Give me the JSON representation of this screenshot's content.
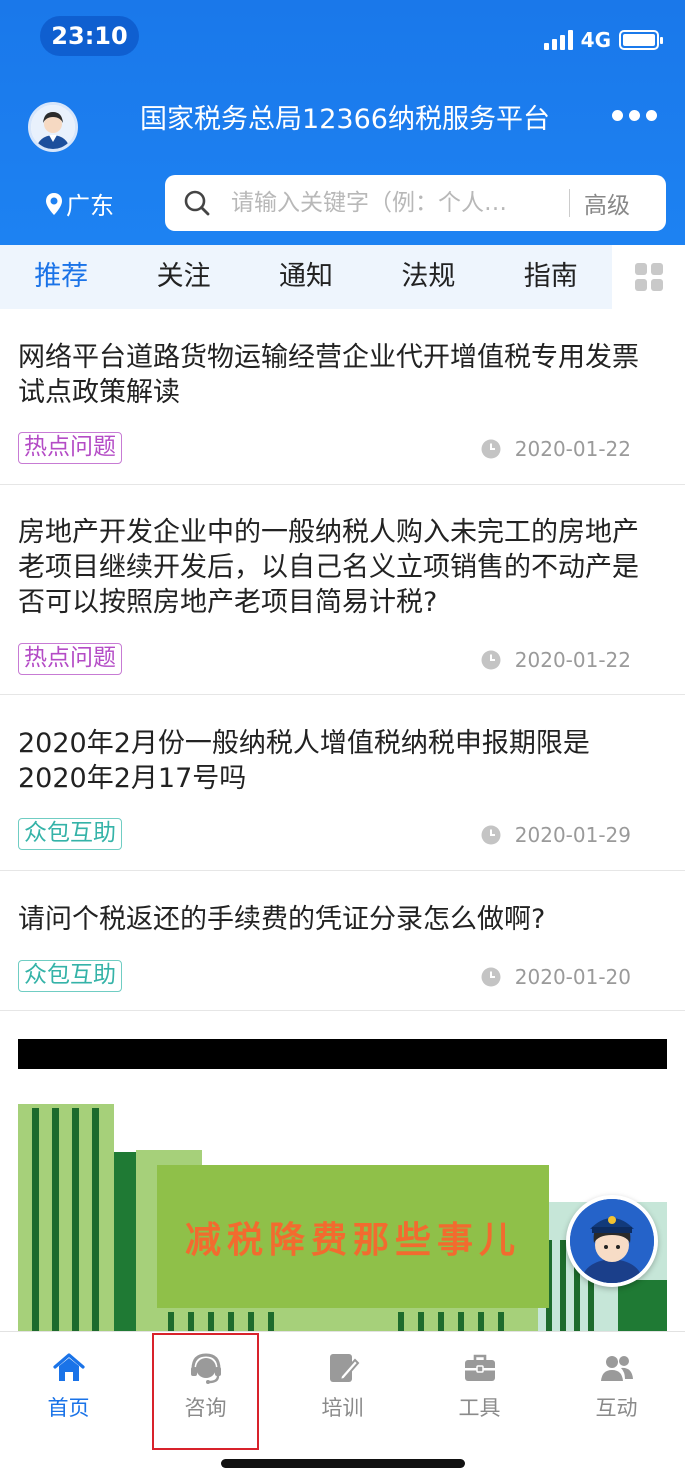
{
  "status_bar": {
    "time": "23:10",
    "network": "4G"
  },
  "header": {
    "title": "国家税务总局12366纳税服务平台",
    "location": "广东",
    "search": {
      "placeholder": "请输入关键字（例：个人…",
      "advanced_label": "高级"
    }
  },
  "tabs": [
    {
      "label": "推荐",
      "active": true
    },
    {
      "label": "关注",
      "active": false
    },
    {
      "label": "通知",
      "active": false
    },
    {
      "label": "法规",
      "active": false
    },
    {
      "label": "指南",
      "active": false
    }
  ],
  "articles": [
    {
      "title": "网络平台道路货物运输经营企业代开增值税专用发票试点政策解读",
      "tag": "热点问题",
      "date": "2020-01-22"
    },
    {
      "title": "房地产开发企业中的一般纳税人购入未完工的房地产老项目继续开发后，以自己名义立项销售的不动产是否可以按照房地产老项目简易计税?",
      "tag": "热点问题",
      "date": "2020-01-22"
    },
    {
      "title": "2020年2月份一般纳税人增值税纳税申报期限是2020年2月17号吗",
      "tag": "众包互助",
      "date": "2020-01-29"
    },
    {
      "title": "请问个税返还的手续费的凭证分录怎么做啊?",
      "tag": "众包互助",
      "date": "2020-01-20"
    }
  ],
  "banner": {
    "text": "减税降费那些事儿"
  },
  "bottom_nav": [
    {
      "label": "首页",
      "icon": "home-icon",
      "active": true
    },
    {
      "label": "咨询",
      "icon": "headset-icon",
      "active": false
    },
    {
      "label": "培训",
      "icon": "edit-icon",
      "active": false
    },
    {
      "label": "工具",
      "icon": "briefcase-icon",
      "active": false
    },
    {
      "label": "互动",
      "icon": "users-icon",
      "active": false
    }
  ],
  "colors": {
    "primary": "#1a78ea",
    "hot_tag": "#b44cc6",
    "crowd_tag": "#35b3a8",
    "highlight": "#d8222b",
    "banner_text": "#f26b2f"
  }
}
